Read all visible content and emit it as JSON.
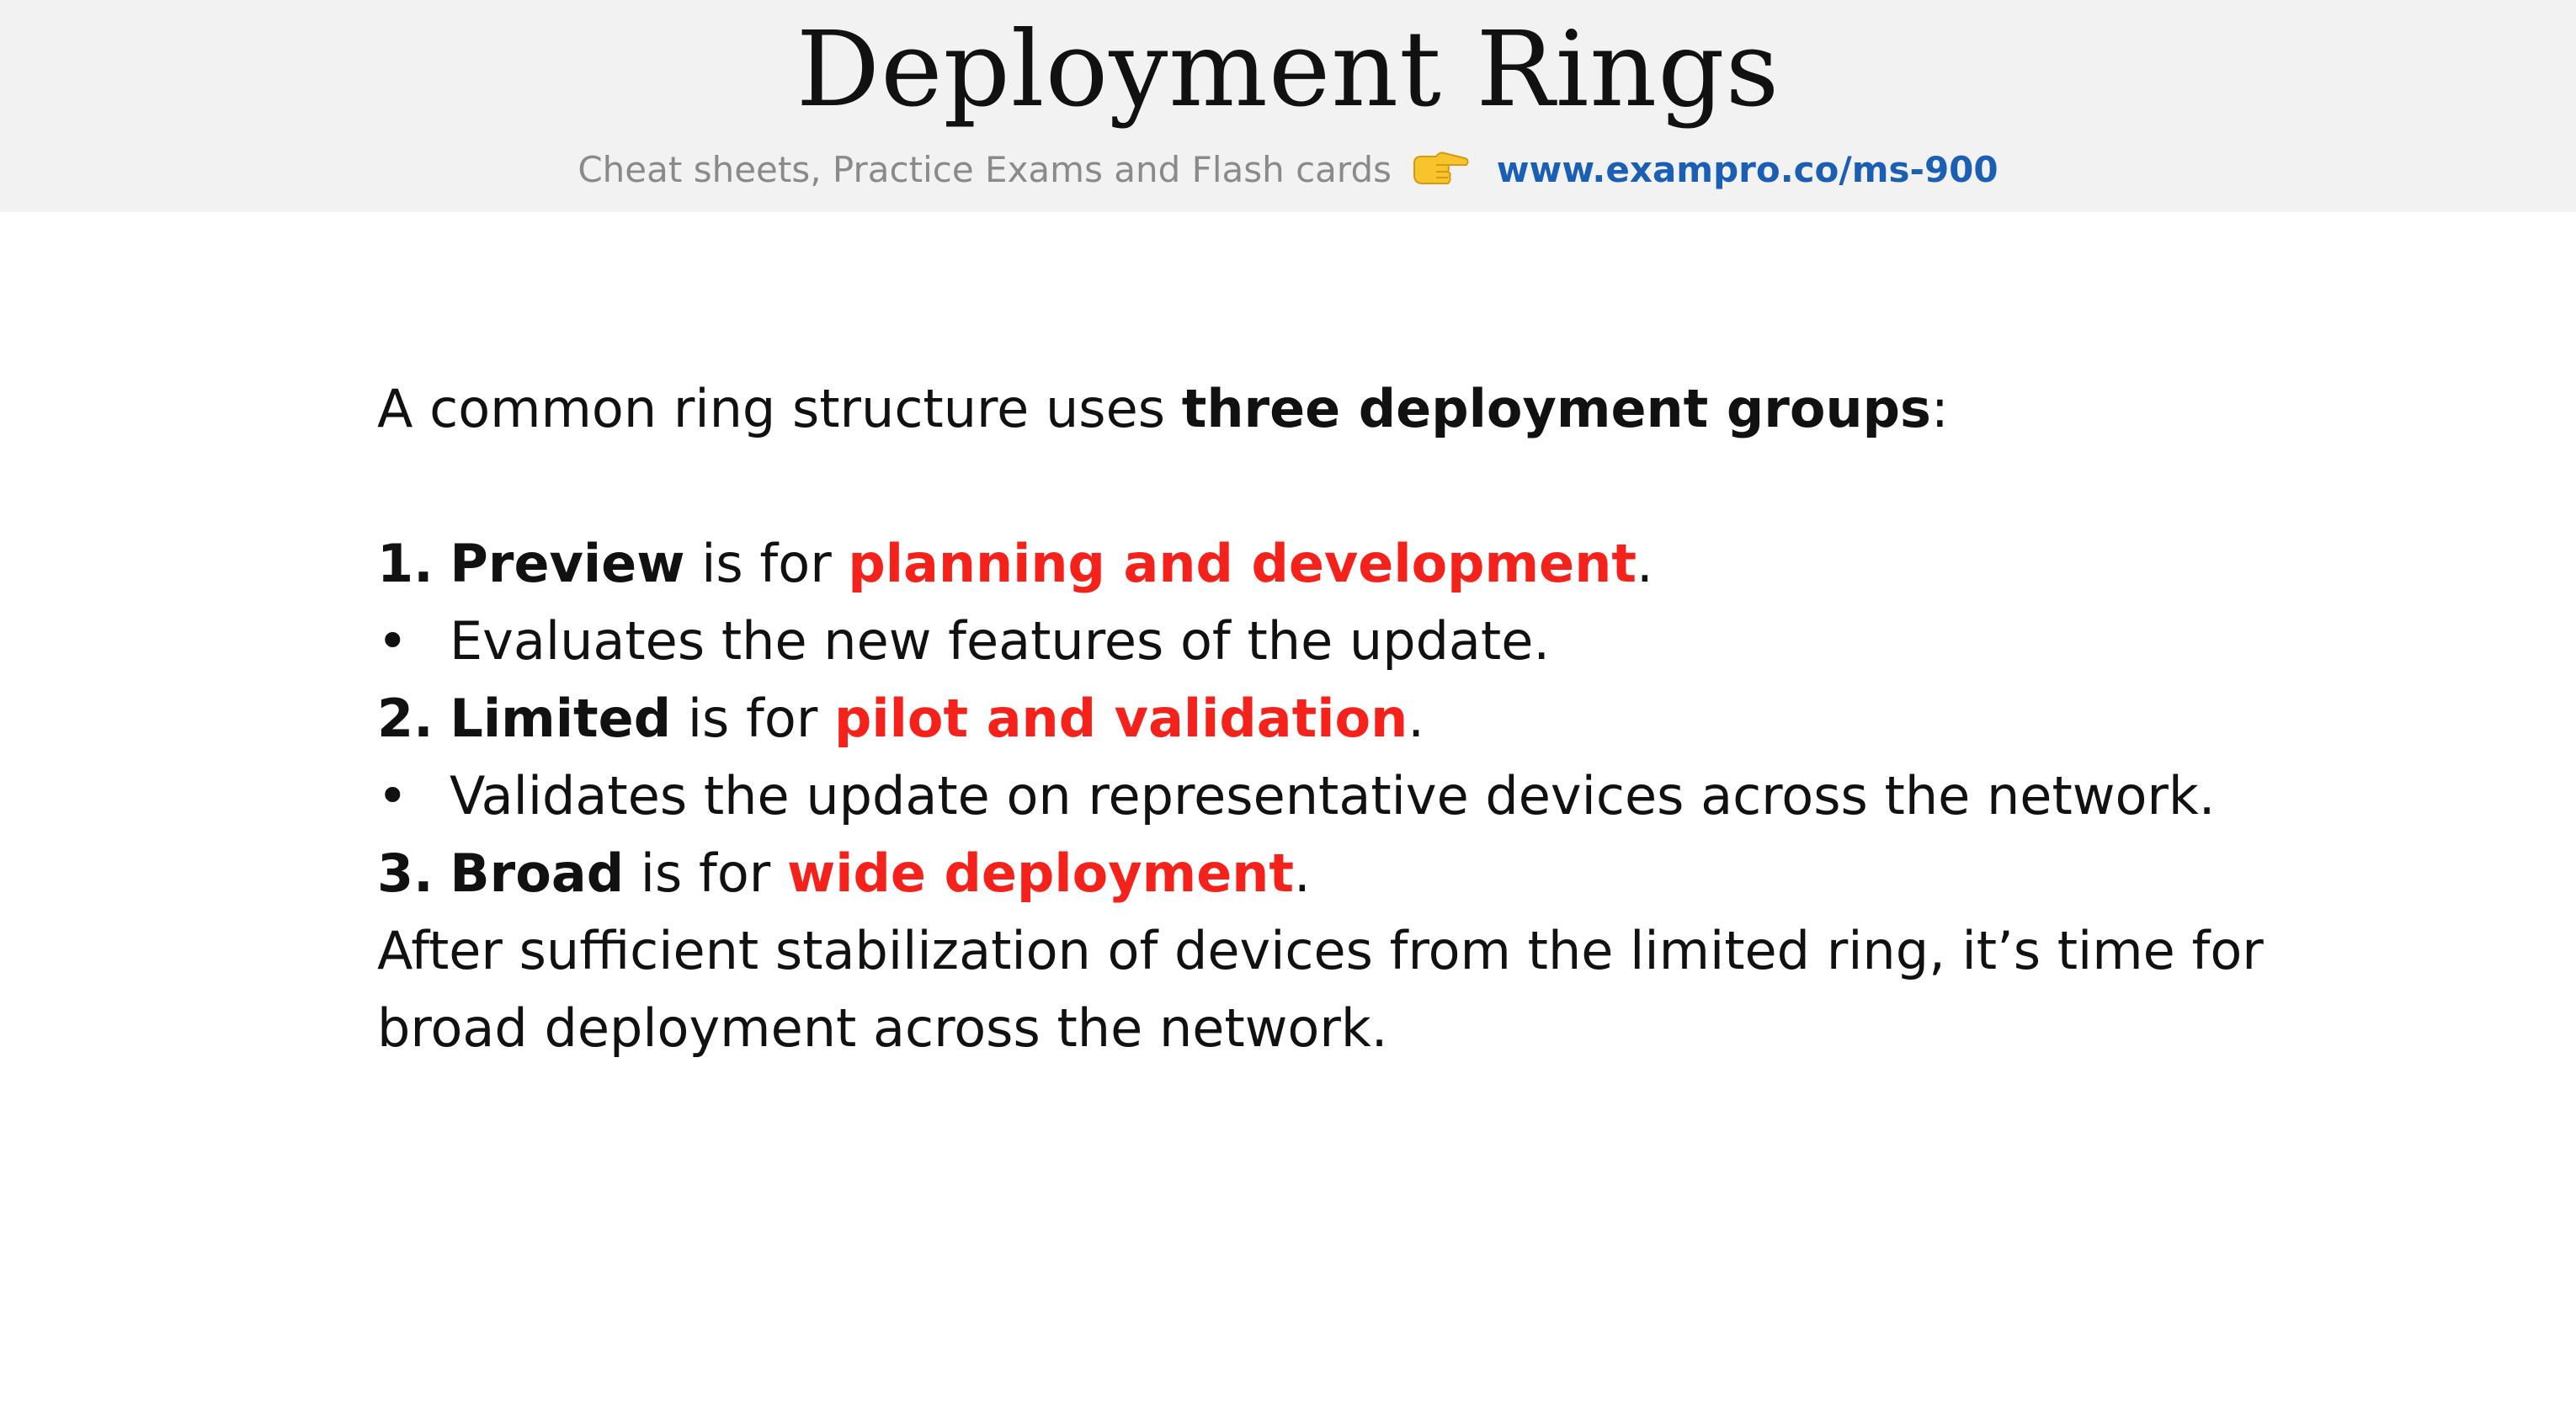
{
  "header": {
    "title": "Deployment Rings",
    "subtitle_text": "Cheat sheets, Practice Exams and Flash cards",
    "pointer_icon": "pointing-hand-icon",
    "link_text": "www.exampro.co/ms-900",
    "link_color": "#1a5fb4"
  },
  "body": {
    "intro_prefix": "A common ring structure uses ",
    "intro_bold": "three deployment groups",
    "intro_suffix": ":",
    "items": [
      {
        "number": "1.",
        "name": "Preview",
        "mid": " is for ",
        "purpose": "planning and development",
        "end": ".",
        "bullet": "Evaluates the new features of the update."
      },
      {
        "number": "2.",
        "name": "Limited",
        "mid": " is for ",
        "purpose": "pilot and validation",
        "end": ".",
        "bullet": "Validates the update on representative devices across the network."
      },
      {
        "number": "3.",
        "name": "Broad",
        "mid": " is for ",
        "purpose": "wide deployment",
        "end": "."
      }
    ],
    "closing_line_1": "After sufficient stabilization of devices from the limited ring, it’s time for",
    "closing_line_2": "broad deployment across the network.",
    "bullet_symbol": "•",
    "accent_color": "#f4221b"
  }
}
